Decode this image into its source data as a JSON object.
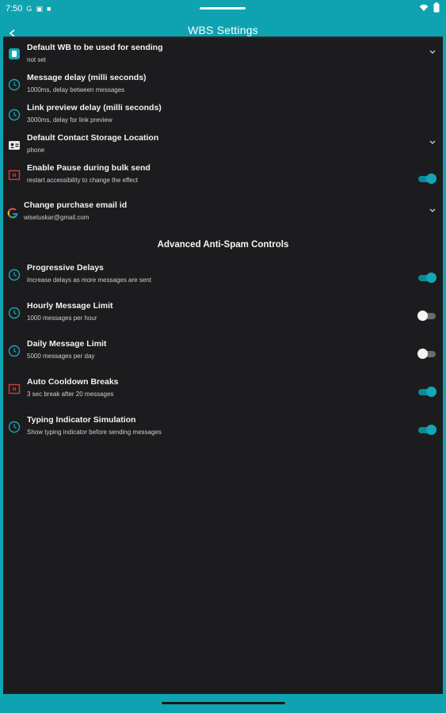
{
  "status_bar": {
    "time": "7:50",
    "left_glyphs": [
      "G",
      "▣",
      "■"
    ]
  },
  "app_bar": {
    "title": "WBS Settings"
  },
  "settings": [
    {
      "title": "Default WB to be used for sending",
      "subtitle": "not set",
      "icon": "whatsapp-business-icon",
      "control": "chevron"
    },
    {
      "title": "Message delay (milli seconds)",
      "subtitle": "1000ms, delay between messages",
      "icon": "clock-icon",
      "control": "none"
    },
    {
      "title": "Link preview delay (milli seconds)",
      "subtitle": "3000ms, delay for link preview",
      "icon": "clock-icon",
      "control": "none"
    },
    {
      "title": "Default Contact Storage Location",
      "subtitle": "phone",
      "icon": "contact-card-icon",
      "control": "chevron"
    },
    {
      "title": "Enable Pause during bulk send",
      "subtitle": "restart accessibility to change the effect",
      "icon": "pause-icon",
      "control": "toggle",
      "on": true
    },
    {
      "title": "Change purchase email id",
      "subtitle": "wisetuskar@gmail.com",
      "icon": "google-icon",
      "control": "chevron"
    }
  ],
  "advanced": {
    "heading": "Advanced Anti-Spam Controls",
    "items": [
      {
        "title": "Progressive Delays",
        "subtitle": "Increase delays as more messages are sent",
        "icon": "clock-icon",
        "on": true
      },
      {
        "title": "Hourly Message Limit",
        "subtitle": "1000 messages per hour",
        "icon": "clock-icon",
        "on": false
      },
      {
        "title": "Daily Message Limit",
        "subtitle": "5000 messages per day",
        "icon": "clock-icon",
        "on": false
      },
      {
        "title": "Auto Cooldown Breaks",
        "subtitle": "3 sec break after 20 messages",
        "icon": "pause-icon",
        "on": true
      },
      {
        "title": "Typing Indicator Simulation",
        "subtitle": "Show typing indicator before sending messages",
        "icon": "clock-icon",
        "on": true
      }
    ]
  },
  "colors": {
    "accent": "#0fa3b1",
    "background": "#1c1c1e",
    "pause_red": "#d23a3a"
  }
}
